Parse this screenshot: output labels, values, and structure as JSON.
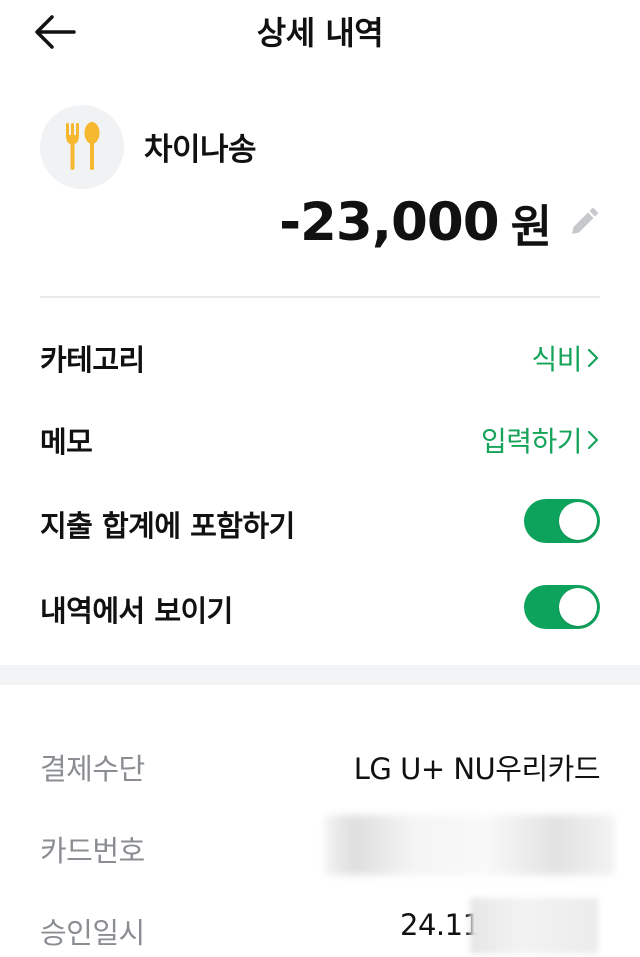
{
  "header": {
    "title": "상세 내역",
    "back_icon": "arrow-left-icon"
  },
  "merchant": {
    "name": "차이나송",
    "icon": "fork-spoon-icon",
    "icon_color": "#f5b82e"
  },
  "amount": {
    "value": "-23,000",
    "unit": "원",
    "edit_icon": "pencil-icon"
  },
  "settings": {
    "category": {
      "label": "카테고리",
      "value": "식비"
    },
    "memo": {
      "label": "메모",
      "value": "입력하기"
    },
    "include_total": {
      "label": "지출 합계에 포함하기",
      "on": true
    },
    "show_in_history": {
      "label": "내역에서 보이기",
      "on": true
    }
  },
  "details": {
    "payment_method": {
      "label": "결제수단",
      "value": "LG U+ NU우리카드"
    },
    "card_number": {
      "label": "카드번호",
      "value": ""
    },
    "approved_at": {
      "label": "승인일시",
      "value": "24.11"
    }
  },
  "colors": {
    "accent_green": "#16a35a",
    "toggle_green": "#0ea35c"
  }
}
